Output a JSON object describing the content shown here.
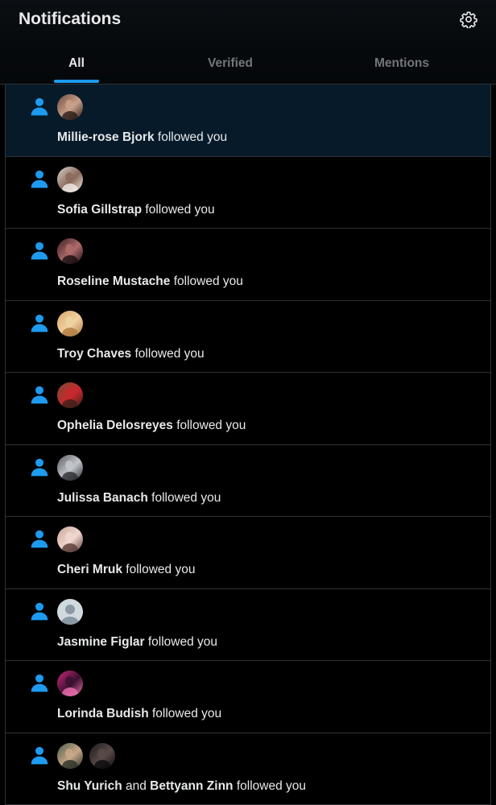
{
  "header": {
    "title": "Notifications",
    "settings_icon": "gear-icon"
  },
  "tabs": [
    {
      "label": "All",
      "active": true
    },
    {
      "label": "Verified",
      "active": false
    },
    {
      "label": "Mentions",
      "active": false
    }
  ],
  "notifications": [
    {
      "names": [
        "Millie-rose Bjork"
      ],
      "joiner": "",
      "action": "followed you",
      "highlighted": true,
      "avatars": [
        {
          "colors": [
            "#6b4a3e",
            "#c9a08a",
            "#2b1a16"
          ]
        }
      ]
    },
    {
      "names": [
        "Sofia Gillstrap"
      ],
      "joiner": "",
      "action": "followed you",
      "highlighted": false,
      "avatars": [
        {
          "colors": [
            "#d8d0cc",
            "#8a6a5a",
            "#f2ece8"
          ]
        }
      ]
    },
    {
      "names": [
        "Roseline Mustache"
      ],
      "joiner": "",
      "action": "followed you",
      "highlighted": false,
      "avatars": [
        {
          "colors": [
            "#3a1e22",
            "#b06a6a",
            "#1a0c10"
          ]
        }
      ]
    },
    {
      "names": [
        "Troy Chaves"
      ],
      "joiner": "",
      "action": "followed you",
      "highlighted": false,
      "avatars": [
        {
          "colors": [
            "#d9a868",
            "#f0d2a2",
            "#b07a40"
          ]
        }
      ]
    },
    {
      "names": [
        "Ophelia Delosreyes"
      ],
      "joiner": "",
      "action": "followed you",
      "highlighted": false,
      "avatars": [
        {
          "colors": [
            "#7a4a32",
            "#c8282e",
            "#3a2018"
          ]
        }
      ]
    },
    {
      "names": [
        "Julissa Banach"
      ],
      "joiner": "",
      "action": "followed you",
      "highlighted": false,
      "avatars": [
        {
          "colors": [
            "#5a5a60",
            "#c2c6cc",
            "#2a2a30"
          ]
        }
      ]
    },
    {
      "names": [
        "Cheri Mruk"
      ],
      "joiner": "",
      "action": "followed you",
      "highlighted": false,
      "avatars": [
        {
          "colors": [
            "#caa69a",
            "#f0d8d0",
            "#5a3a34"
          ]
        }
      ]
    },
    {
      "names": [
        "Jasmine Figlar"
      ],
      "joiner": "",
      "action": "followed you",
      "highlighted": false,
      "avatars": [
        {
          "colors": [
            "default"
          ]
        }
      ]
    },
    {
      "names": [
        "Lorinda Budish"
      ],
      "joiner": "",
      "action": "followed you",
      "highlighted": false,
      "avatars": [
        {
          "colors": [
            "#d02880",
            "#3a1030",
            "#f070b0"
          ]
        }
      ]
    },
    {
      "names": [
        "Shu Yurich",
        "Bettyann Zinn"
      ],
      "joiner": "and",
      "action": "followed you",
      "highlighted": false,
      "avatars": [
        {
          "colors": [
            "#4a5a48",
            "#c8a888",
            "#2a3028"
          ]
        },
        {
          "colors": [
            "#1a1a1e",
            "#5a4a48",
            "#0a0a0c"
          ]
        }
      ]
    }
  ],
  "colors": {
    "accent": "#1d9bf0",
    "highlight_row": "#061a2a",
    "divider": "#2f3336",
    "muted_text": "#71767b"
  }
}
